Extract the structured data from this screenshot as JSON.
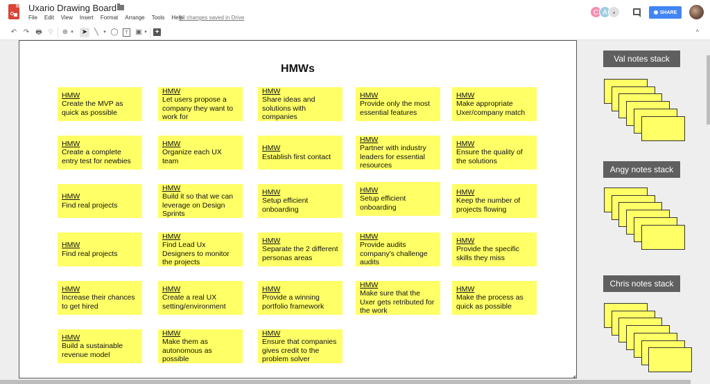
{
  "header": {
    "app_icon": "drawings-logo-icon",
    "title": "Uxario Drawing Board",
    "star_icon": "star-icon",
    "folder_icon": "folder-icon",
    "menu": [
      "File",
      "Edit",
      "View",
      "Insert",
      "Format",
      "Arrange",
      "Tools",
      "Help"
    ],
    "save_status": "All changes saved in Drive",
    "collaborators": [
      {
        "initial": "C",
        "color": "#f48fb1"
      },
      {
        "initial": "A",
        "color": "#9ecfe0"
      }
    ],
    "more_collaborators_icon": "people-icon",
    "comments_icon": "comment-icon",
    "share_label": "SHARE",
    "share_color": "#4285f4",
    "user_avatar": "user-avatar"
  },
  "toolbar": {
    "undo": "↶",
    "redo": "↷",
    "print": "🖶",
    "paint_format": "⚲",
    "zoom": "⊕",
    "select": "➤",
    "line": "╲",
    "shape": "◯",
    "textbox": "T",
    "image": "▣",
    "comment": "+",
    "dropdown": "▾",
    "collapse": "^"
  },
  "canvas": {
    "title": "HMWs",
    "sticky_color": "#ffff66",
    "notes": [
      {
        "heading": "HMW",
        "text": "Create the MVP as quick as possible"
      },
      {
        "heading": "HMW",
        "text": "Let users propose a company they want to work for"
      },
      {
        "heading": "HMW",
        "text": "Share ideas and solutions with companies"
      },
      {
        "heading": "HMW",
        "text": "Provide only the most essential features"
      },
      {
        "heading": "HMW",
        "text": "Make appropriate Uxer/company match"
      },
      {
        "heading": "HMW",
        "text": "Create a complete entry test for newbies"
      },
      {
        "heading": "HMW",
        "text": "Organize each UX team"
      },
      {
        "heading": "HMW",
        "text": "Establish first contact"
      },
      {
        "heading": "HMW",
        "text": "Partner with industry leaders for essential resources"
      },
      {
        "heading": "HMW",
        "text": "Ensure the quality of the solutions"
      },
      {
        "heading": "HMW",
        "text": "Find real projects"
      },
      {
        "heading": "HMW",
        "text": "Build it so that we can leverage on Design Sprints"
      },
      {
        "heading": "HMW",
        "text": "Setup efficient onboarding"
      },
      {
        "heading": "HMW",
        "text": "Setup efficient onboarding"
      },
      {
        "heading": "HMW",
        "text": "Keep the number of projects flowing"
      },
      {
        "heading": "HMW",
        "text": "Find real projects"
      },
      {
        "heading": "HMW",
        "text": "Find Lead Ux Designers to monitor the projects"
      },
      {
        "heading": "HMW",
        "text": "Separate the 2 different personas areas"
      },
      {
        "heading": "HMW",
        "text": "Provide audits company's challenge audits"
      },
      {
        "heading": "HMW",
        "text": "Provide the specific skills they miss"
      },
      {
        "heading": "HMW",
        "text": "Increase their chances to get hired"
      },
      {
        "heading": "HMW",
        "text": "Create a real UX setting/environment"
      },
      {
        "heading": "HMW",
        "text": "Provide a winning portfolio framework"
      },
      {
        "heading": "HMW",
        "text": "Make sure that the Uxer gets retributed for the work"
      },
      {
        "heading": "HMW",
        "text": "Make the process as quick as possible"
      },
      {
        "heading": "HMW",
        "text": "Build a sustainable revenue model"
      },
      {
        "heading": "HMW",
        "text": "Make them as autonomous as possible"
      },
      {
        "heading": "HMW",
        "text": "Ensure that companies gives credit to the problem solver"
      }
    ]
  },
  "side_panel": {
    "stacks": [
      {
        "label": "Val notes stack",
        "card_count": 6
      },
      {
        "label": "Angy notes stack",
        "card_count": 6
      },
      {
        "label": "Chris notes stack",
        "card_count": 7
      }
    ]
  }
}
